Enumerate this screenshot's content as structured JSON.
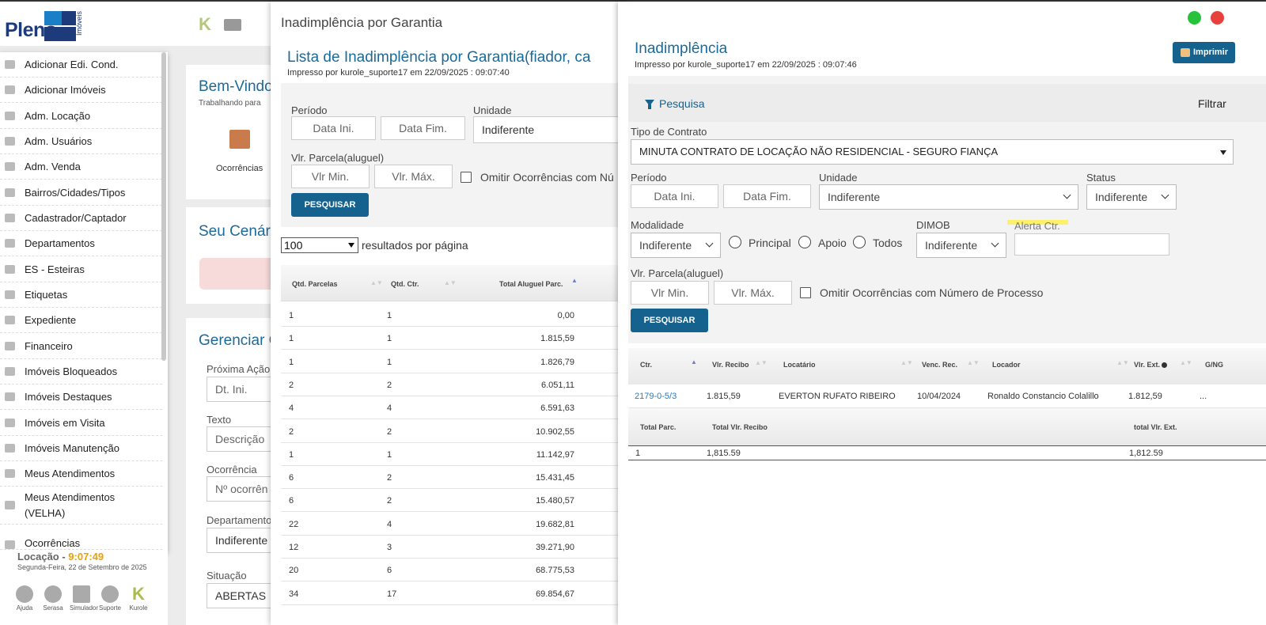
{
  "brand": {
    "name": "Pleno",
    "sub": "Imóveis",
    "k_icon": "K"
  },
  "sidebar": {
    "items": [
      {
        "label": "Adicionar Edi. Cond.",
        "icon": "home-icon"
      },
      {
        "label": "Adicionar Imóveis",
        "icon": "home-icon"
      },
      {
        "label": "Adm. Locação",
        "icon": "gears-icon"
      },
      {
        "label": "Adm. Usuários",
        "icon": "users-icon"
      },
      {
        "label": "Adm. Venda",
        "icon": "gears-icon"
      },
      {
        "label": "Bairros/Cidades/Tipos",
        "icon": "gears-icon"
      },
      {
        "label": "Cadastrador/Captador",
        "icon": "user-icon"
      },
      {
        "label": "Departamentos",
        "icon": "gears-icon"
      },
      {
        "label": "ES - Esteiras",
        "icon": "chart-icon"
      },
      {
        "label": "Etiquetas",
        "icon": "tag-icon"
      },
      {
        "label": "Expediente",
        "icon": "calendar-icon"
      },
      {
        "label": "Financeiro",
        "icon": "money-icon"
      },
      {
        "label": "Imóveis Bloqueados",
        "icon": "lock-icon"
      },
      {
        "label": "Imóveis Destaques",
        "icon": "star-icon"
      },
      {
        "label": "Imóveis em Visita",
        "icon": "shuffle-icon"
      },
      {
        "label": "Imóveis Manutenção",
        "icon": "gears-icon"
      },
      {
        "label": "Meus Atendimentos",
        "icon": "contact-icon"
      },
      {
        "label": "Meus Atendimentos (VELHA)",
        "icon": "contact-icon"
      },
      {
        "label": "Ocorrências",
        "icon": "folder-icon"
      }
    ]
  },
  "clock": {
    "prefix": "Locação - ",
    "time": "9:07:49",
    "date": "Segunda-Feira, 22 de Setembro de 2025"
  },
  "bottom_icons": [
    {
      "label": "Ajuda"
    },
    {
      "label": "Serasa"
    },
    {
      "label": "Simulador"
    },
    {
      "label": "Suporte"
    },
    {
      "label": "Kurole"
    }
  ],
  "background": {
    "welcome_title": "Bem-Vindo",
    "welcome_sub": "Trabalhando para",
    "ocorrencias": "Ocorrências",
    "scenario_title": "Seu Cenário",
    "manage_title": "Gerenciar O",
    "proxima_acao": "Próxima Ação",
    "dt_ini": "Dt. Ini.",
    "texto": "Texto",
    "descricao": "Descrição",
    "ocorrencia": "Ocorrência",
    "n_ocorrencia": "Nº ocorrên",
    "departamento": "Departamento",
    "indiferente": "Indiferente",
    "situacao": "Situação",
    "abertas": "ABERTAS"
  },
  "middle": {
    "header": "Inadimplência por Garantia",
    "title": "Lista de Inadimplência por Garantia(fiador, ca",
    "printed": "Impresso por kurole_suporte17 em 22/09/2025 : 09:07:40",
    "periodo": "Período",
    "data_ini": "Data Ini.",
    "data_fim": "Data Fim.",
    "unidade": "Unidade",
    "unidade_value": "Indiferente",
    "vlr_parcela": "Vlr. Parcela(aluguel)",
    "vlr_min": "Vlr Min.",
    "vlr_max": "Vlr. Máx.",
    "omitir": "Omitir Ocorrências com Nú",
    "pesquisar": "PESQUISAR",
    "per_page_value": "100",
    "per_page_label": "resultados por página",
    "columns": [
      "Qtd. Parcelas",
      "Qtd. Ctr.",
      "Total Aluguel Parc."
    ],
    "rows": [
      [
        "1",
        "1",
        "0,00"
      ],
      [
        "1",
        "1",
        "1.815,59"
      ],
      [
        "1",
        "1",
        "1.826,79"
      ],
      [
        "2",
        "2",
        "6.051,11"
      ],
      [
        "4",
        "4",
        "6.591,63"
      ],
      [
        "2",
        "2",
        "10.902,55"
      ],
      [
        "1",
        "1",
        "11.142,97"
      ],
      [
        "6",
        "2",
        "15.431,45"
      ],
      [
        "6",
        "2",
        "15.480,57"
      ],
      [
        "22",
        "4",
        "19.682,81"
      ],
      [
        "12",
        "3",
        "39.271,90"
      ],
      [
        "20",
        "6",
        "68.775,53"
      ],
      [
        "34",
        "17",
        "69.854,67"
      ]
    ]
  },
  "right": {
    "title": "Inadimplência",
    "printed": "Impresso por kurole_suporte17 em 22/09/2025 : 09:07:46",
    "print_btn": "Imprimir",
    "pesquisa": "Pesquisa",
    "filtrar": "Filtrar",
    "tipo_contrato": "Tipo de Contrato",
    "tipo_contrato_value": "MINUTA CONTRATO DE LOCAÇÃO NÃO RESIDENCIAL - SEGURO FIANÇA",
    "periodo": "Período",
    "data_ini": "Data Ini.",
    "data_fim": "Data Fim.",
    "unidade": "Unidade",
    "unidade_value": "Indiferente",
    "status": "Status",
    "status_value": "Indiferente",
    "modalidade": "Modalidade",
    "modalidade_value": "Indiferente",
    "principal": "Principal",
    "apoio": "Apoio",
    "todos": "Todos",
    "dimob": "DIMOB",
    "dimob_value": "Indiferente",
    "alerta": "Alerta Ctr.",
    "vlr_parcela": "Vlr. Parcela(aluguel)",
    "vlr_min": "Vlr Min.",
    "vlr_max": "Vlr. Máx.",
    "omitir": "Omitir Ocorrências com Número de Processo",
    "pesquisar": "PESQUISAR",
    "columns": [
      "Ctr.",
      "Vlr. Recibo",
      "Locatário",
      "Venc. Rec.",
      "Locador",
      "Vlr. Ext.",
      "G/NG"
    ],
    "row": [
      "2179-0-5/3",
      "1.815,59",
      "EVERTON RUFATO RIBEIRO",
      "10/04/2024",
      "Ronaldo Constancio Colalillo",
      "1.812,59",
      "..."
    ],
    "total_columns": [
      "Total Parc.",
      "Total Vlr. Recibo",
      "total Vlr. Ext."
    ],
    "total_row": [
      "1",
      "1,815.59",
      "1,812.59"
    ],
    "colors": {
      "accent": "#16628f",
      "green_dot": "#27c23b",
      "red_dot": "#e8413c"
    }
  }
}
